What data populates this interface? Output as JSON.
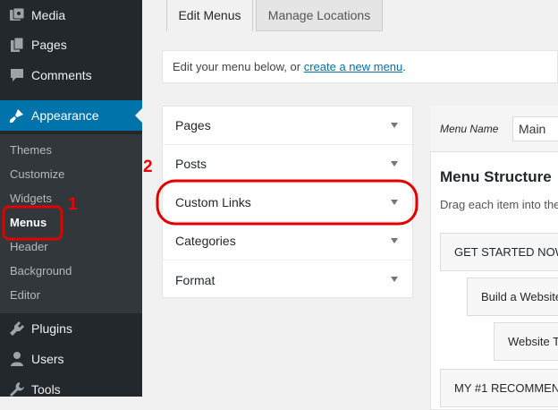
{
  "sidebar": {
    "items": [
      {
        "label": "Media",
        "icon": "media-icon"
      },
      {
        "label": "Pages",
        "icon": "pages-icon"
      },
      {
        "label": "Comments",
        "icon": "comments-icon"
      },
      {
        "label": "Appearance",
        "icon": "paintbrush-icon"
      },
      {
        "label": "Plugins",
        "icon": "plugins-icon"
      },
      {
        "label": "Users",
        "icon": "users-icon"
      },
      {
        "label": "Tools",
        "icon": "tools-icon"
      }
    ],
    "submenu": [
      "Themes",
      "Customize",
      "Widgets",
      "Menus",
      "Header",
      "Background",
      "Editor"
    ]
  },
  "tabs": {
    "edit_menus": "Edit Menus",
    "manage_locations": "Manage Locations"
  },
  "notice": {
    "prefix": "Edit your menu below, or ",
    "link": "create a new menu",
    "suffix": "."
  },
  "accordion": [
    "Pages",
    "Posts",
    "Custom Links",
    "Categories",
    "Format"
  ],
  "menu_name": {
    "label": "Menu Name",
    "value": "Main"
  },
  "structure": {
    "title": "Menu Structure",
    "description": "Drag each item into the",
    "items": [
      "GET STARTED NOW",
      "Build a Website",
      "Website T",
      "MY #1 RECOMMEN"
    ]
  },
  "annotations": {
    "one": "1",
    "two": "2",
    "color": "#e00000"
  }
}
